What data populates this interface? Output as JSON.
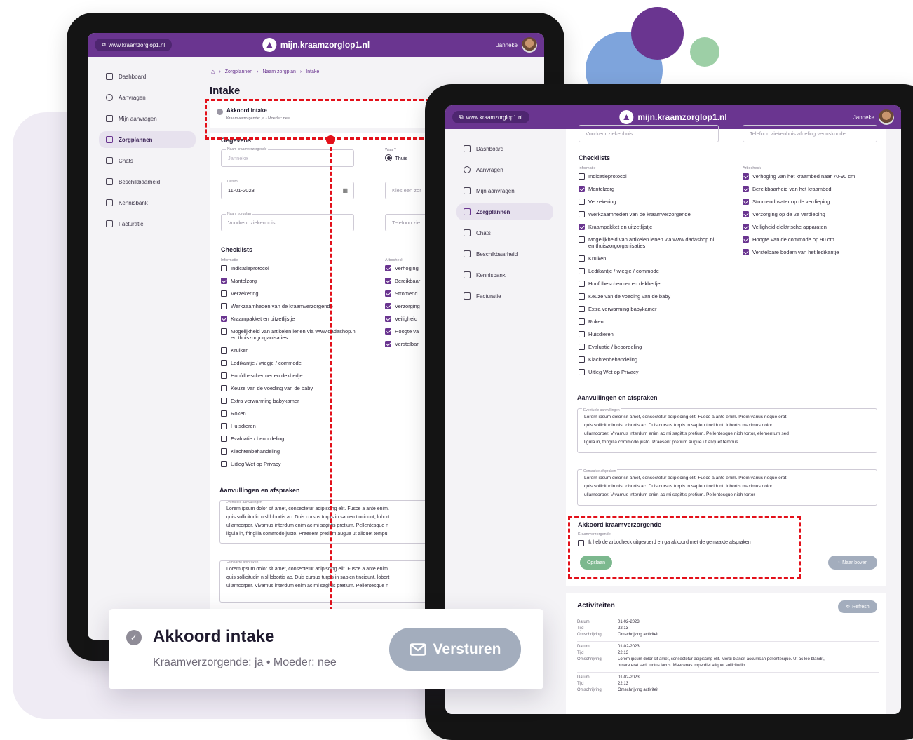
{
  "topbar": {
    "url": "www.kraamzorglop1.nl",
    "site_title": "mijn.kraamzorglop1.nl",
    "user_name": "Janneke"
  },
  "sidebar": {
    "items": [
      {
        "label": "Dashboard",
        "icon": "home-icon"
      },
      {
        "label": "Aanvragen",
        "icon": "search-icon"
      },
      {
        "label": "Mijn aanvragen",
        "icon": "grid-icon"
      },
      {
        "label": "Zorgplannen",
        "icon": "list-icon"
      },
      {
        "label": "Chats",
        "icon": "chat-icon"
      },
      {
        "label": "Beschikbaarheid",
        "icon": "calendar-icon"
      },
      {
        "label": "Kennisbank",
        "icon": "book-icon"
      },
      {
        "label": "Facturatie",
        "icon": "document-icon"
      }
    ]
  },
  "back": {
    "breadcrumb": [
      "Zorgplannen",
      "Naam zorgplan",
      "Intake"
    ],
    "page_title": "Intake",
    "intake_title": "Akkoord intake",
    "intake_sub": "Kraamverzorgende: ja • Moeder: nee",
    "gegevens_title": "Gegevens",
    "name_label": "Naam kraamverzorgende",
    "name_value": "Janneke",
    "waar_label": "Waar?",
    "waar_option": "Thuis",
    "date_label": "Datum",
    "date_value": "11-01-2023",
    "ziekenhuis_label": "Naam zorgplan",
    "ziekenhuis_placeholder": "Voorkeur ziekenhuis",
    "kies_placeholder": "Kies een zor",
    "telefoon_placeholder": "Telefoon zie",
    "checklists_title": "Checklists",
    "informatie_label": "Informatie",
    "arbocheck_label": "Arbocheck",
    "informatie_items": [
      {
        "label": "Indicatieprotocol",
        "checked": false
      },
      {
        "label": "Mantelzorg",
        "checked": true
      },
      {
        "label": "Verzekering",
        "checked": false
      },
      {
        "label": "Werkzaamheden van de kraamverzorgende",
        "checked": false
      },
      {
        "label": "Kraampakket en uitzetlijstje",
        "checked": true
      },
      {
        "label": "Mogelijkheid van artikelen lenen via www.dadashop.nl",
        "label2": "en thuiszorgorganisaties",
        "checked": false
      },
      {
        "label": "Kruiken",
        "checked": false
      },
      {
        "label": "Ledikantje / wiegje / commode",
        "checked": false
      },
      {
        "label": "Hoofdbeschermer en dekbedje",
        "checked": false
      },
      {
        "label": "Keuze van de voeding van de baby",
        "checked": false
      },
      {
        "label": "Extra verwarming babykamer",
        "checked": false
      },
      {
        "label": "Roken",
        "checked": false
      },
      {
        "label": "Huisdieren",
        "checked": false
      },
      {
        "label": "Evaluatie / beoordeling",
        "checked": false
      },
      {
        "label": "Klachtenbehandeling",
        "checked": false
      },
      {
        "label": "Uitleg Wet op Privacy",
        "checked": false
      }
    ],
    "arbo_items": [
      "Verhoging",
      "Bereikbaar",
      "Stromend",
      "Verzorging",
      "Veiligheid",
      "Hoogte va",
      "Verstelbar"
    ],
    "aanvullingen_title": "Aanvullingen en afspraken",
    "eventuele_label": "Eventuele aanvullingen",
    "eventuele_lines": [
      "Lorem ipsum dolor sit amet, consectetur adipiscing elit. Fusce a ante enim.",
      "quis sollicitudin nisl lobortis ac. Duis cursus turpis in sapien tincidunt, lobort",
      "ullamcorper. Vivamus interdum enim ac mi sagittis pretium. Pellentesque n",
      "ligula in, fringilla commodo justo. Praesent pretium augue ut aliquet tempu"
    ],
    "gemaakte_label": "Gemaakte afspraken",
    "gemaakte_lines": [
      "Lorem ipsum dolor sit amet, consectetur adipiscing elit. Fusce a ante enim.",
      "quis sollicitudin nisl lobortis ac. Duis cursus turpis in sapien tincidunt, lobort",
      "ullamcorper. Vivamus interdum enim ac mi sagittis pretium. Pellentesque n"
    ]
  },
  "callout": {
    "title": "Akkoord intake",
    "subtitle": "Kraamverzorgende: ja • Moeder: nee",
    "button": "Versturen"
  },
  "front": {
    "ziekenhuis_placeholder": "Voorkeur ziekenhuis",
    "telefoon_placeholder": "Telefoon ziekenhuis afdeling verloskunde",
    "checklists_title": "Checklists",
    "informatie_label": "Informatie",
    "arbocheck_label": "Arbocheck",
    "informatie_items": [
      {
        "label": "Indicatieprotocol",
        "checked": false
      },
      {
        "label": "Mantelzorg",
        "checked": true
      },
      {
        "label": "Verzekering",
        "checked": false
      },
      {
        "label": "Werkzaamheden van de kraamverzorgende",
        "checked": false
      },
      {
        "label": "Kraampakket en uitzetlijstje",
        "checked": true
      },
      {
        "label": "Mogelijkheid van artikelen lenen via www.dadashop.nl",
        "label2": "en thuiszorgorganisaties",
        "checked": false
      },
      {
        "label": "Kruiken",
        "checked": false
      },
      {
        "label": "Ledikantje / wiegje / commode",
        "checked": false
      },
      {
        "label": "Hoofdbeschermer en dekbedje",
        "checked": false
      },
      {
        "label": "Keuze van de voeding van de baby",
        "checked": false
      },
      {
        "label": "Extra verwarming babykamer",
        "checked": false
      },
      {
        "label": "Roken",
        "checked": false
      },
      {
        "label": "Huisdieren",
        "checked": false
      },
      {
        "label": "Evaluatie / beoordeling",
        "checked": false
      },
      {
        "label": "Klachtenbehandeling",
        "checked": false
      },
      {
        "label": "Uitleg Wet op Privacy",
        "checked": false
      }
    ],
    "arbo_items": [
      {
        "label": "Verhoging van het kraambed naar 70-90 cm",
        "checked": true
      },
      {
        "label": "Bereikbaarheid van het kraambed",
        "checked": true
      },
      {
        "label": "Stromend water op de verdieping",
        "checked": true
      },
      {
        "label": "Verzorging op de 2e verdieping",
        "checked": true
      },
      {
        "label": "Veiligheid elektrische apparaten",
        "checked": true
      },
      {
        "label": "Hoogte van de commode op 90 cm",
        "checked": true
      },
      {
        "label": "Verstelbare bodem van het ledikantje",
        "checked": true
      }
    ],
    "aanvullingen_title": "Aanvullingen en afspraken",
    "eventuele_label": "Eventuele aanvullingen",
    "eventuele_lines": [
      "Lorem ipsum dolor sit amet, consectetur adipiscing elit. Fusce a ante enim. Proin varius neque erat,",
      "quis sollicitudin nisl lobortis ac. Duis cursus turpis in sapien tincidunt, lobortis maximus dolor",
      "ullamcorper. Vivamus interdum enim ac mi sagittis pretium. Pellentesque nibh tortor, elementum sed",
      "ligula in, fringilla commodo justo. Praesent pretium augue ut aliquet tempus."
    ],
    "gemaakte_label": "Gemaakte afspraken",
    "gemaakte_lines": [
      "Lorem ipsum dolor sit amet, consectetur adipiscing elit. Fusce a ante enim. Proin varius neque erat,",
      "quis sollicitudin nisl lobortis ac. Duis cursus turpis in sapien tincidunt, lobortis maximus dolor",
      "ullamcorper. Vivamus interdum enim ac mi sagittis pretium. Pellentesque nibh tortor"
    ],
    "akkoord_title": "Akkoord kraamverzorgende",
    "akkoord_label": "Kraamverzorgende",
    "akkoord_check": "Ik heb de arbocheck uitgevoerd en ga akkoord met de gemaakte afspraken",
    "save_button": "Opslaan",
    "top_button": "Naar boven",
    "activiteiten_title": "Activiteiten",
    "refresh_button": "Refresh",
    "activity_labels": {
      "datum": "Datum",
      "tijd": "Tijd",
      "omschrijving": "Omschrijving"
    },
    "activities": [
      {
        "datum": "01-02-2023",
        "tijd": "22:13",
        "omschrijving": "Omschrijving activiteit",
        "omschrijving2": ""
      },
      {
        "datum": "01-02-2023",
        "tijd": "22:13",
        "omschrijving": "Lorem ipsum dolor sit amet, consectetur adipiscing elit. Morbi blandit accumsan pellentesque. Ut ac leo blandit,",
        "omschrijving2": "ornare erat sed, luctus lacus. Maecenas imperdiet aliquet sollicitudin."
      },
      {
        "datum": "01-02-2023",
        "tijd": "22:13",
        "omschrijving": "Omschrijving activiteit",
        "omschrijving2": ""
      }
    ]
  },
  "colors": {
    "brand_purple": "#6a3590",
    "highlight_red": "#e3101a",
    "save_green": "#7cb88e",
    "callout_button": "#a3adbd"
  }
}
